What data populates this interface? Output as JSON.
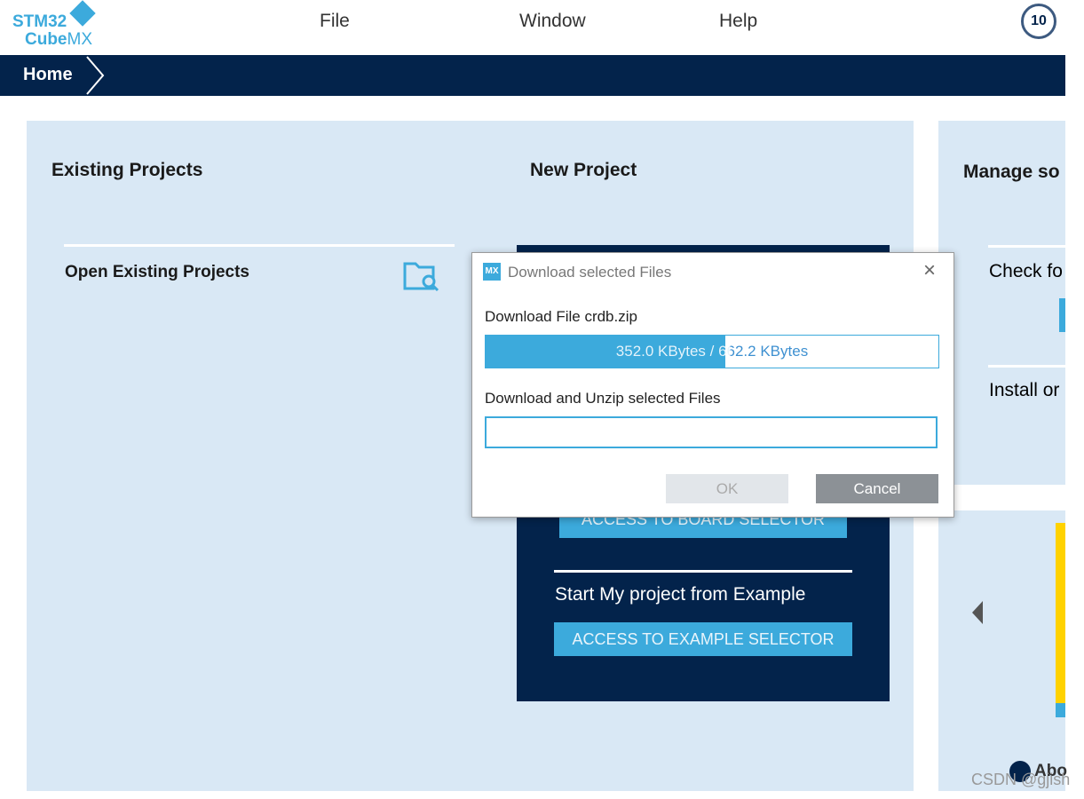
{
  "app": {
    "logo_line1": "STM32",
    "logo_line2": "Cube",
    "logo_line2b": "MX",
    "badge_icon": "anniversary-10-badge"
  },
  "menu": [
    "File",
    "Window",
    "Help"
  ],
  "breadcrumb": {
    "home": "Home"
  },
  "existing": {
    "title": "Existing Projects",
    "open": "Open Existing Projects",
    "icon": "folder-search-icon"
  },
  "new_project": {
    "title": "New Project",
    "board_btn": "ACCESS TO BOARD SELECTOR",
    "example_title": "Start My project from Example",
    "example_btn": "ACCESS TO EXAMPLE SELECTOR"
  },
  "manage": {
    "title": "Manage so",
    "check": "Check fo",
    "install": "Install or",
    "about": "Abo"
  },
  "dialog": {
    "title": "Download selected Files",
    "icon_text": "MX",
    "file_label": "Download File crdb.zip",
    "progress_text": "352.0 KBytes / 662.2 KBytes",
    "progress_percent": 53,
    "unzip_label": "Download and Unzip selected Files",
    "unzip_percent": 0,
    "ok": "OK",
    "cancel": "Cancel"
  },
  "watermark": "CSDN @gjish",
  "colors": {
    "navy": "#03234b",
    "accent": "#3caadc",
    "panel": "#d9e8f5"
  }
}
